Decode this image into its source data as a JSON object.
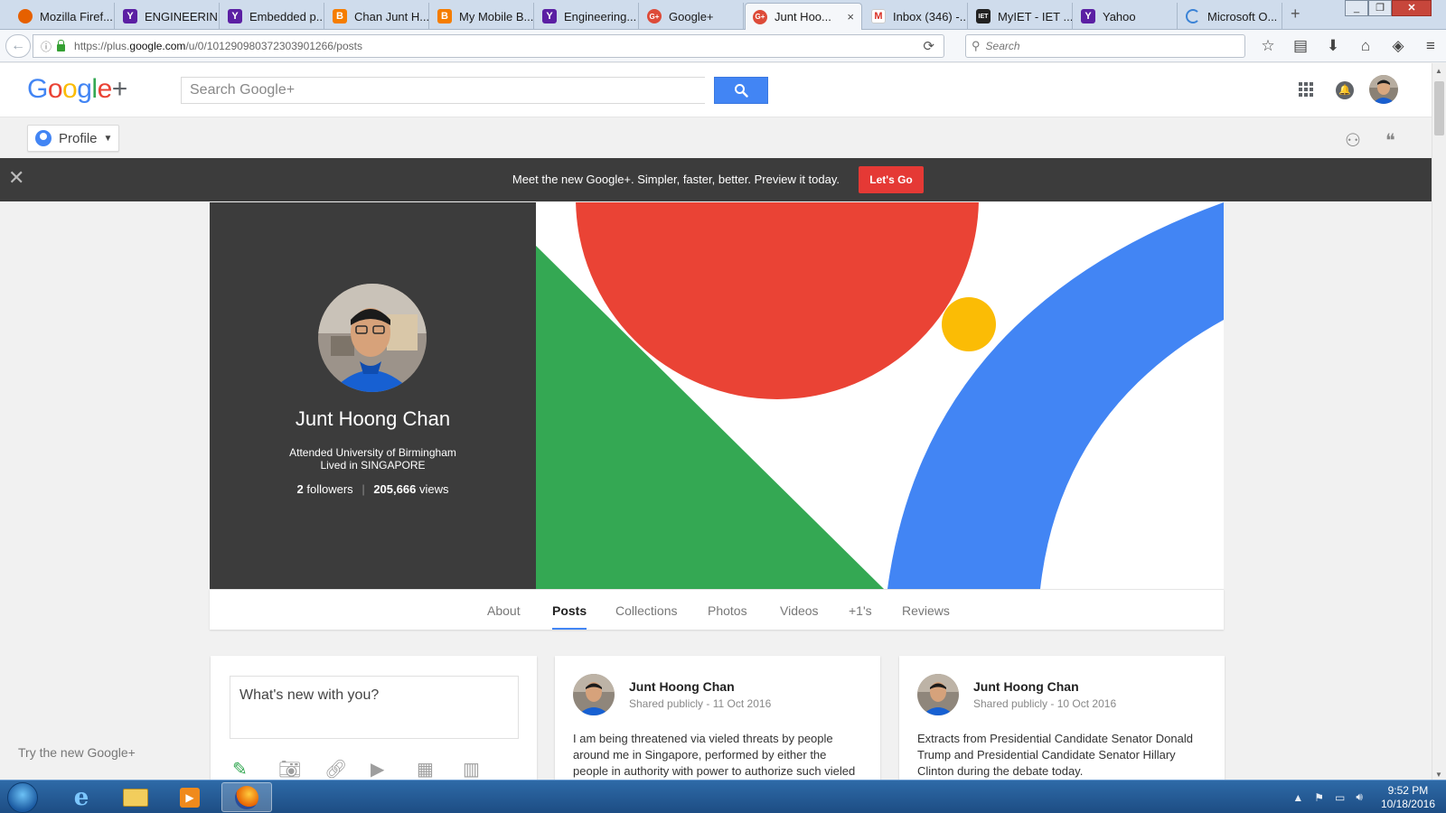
{
  "browser": {
    "tabs": [
      {
        "label": "Mozilla Firef...",
        "favicon": "firefox-icon"
      },
      {
        "label": "ENGINEERIN...",
        "favicon": "yahoo-icon"
      },
      {
        "label": "Embedded p...",
        "favicon": "yahoo-icon"
      },
      {
        "label": "Chan Junt H...",
        "favicon": "blogger-icon"
      },
      {
        "label": "My Mobile B...",
        "favicon": "blogger-icon"
      },
      {
        "label": "Engineering...",
        "favicon": "yahoo-icon"
      },
      {
        "label": "Google+",
        "favicon": "google-plus-icon"
      },
      {
        "label": "Junt Hoo...",
        "favicon": "google-plus-icon",
        "active": true
      },
      {
        "label": "Inbox (346) -...",
        "favicon": "gmail-icon"
      },
      {
        "label": "MyIET - IET ...",
        "favicon": "iet-icon"
      },
      {
        "label": "Yahoo",
        "favicon": "yahoo-icon"
      },
      {
        "label": "Microsoft O...",
        "favicon": "loading-icon"
      }
    ],
    "url_prefix": "https://plus.",
    "url_host": "google.com",
    "url_path": "/u/0/101290980372303901266/posts",
    "search_placeholder": "Search",
    "new_tab_label": "+",
    "close_tab_label": "×"
  },
  "gplus": {
    "search_placeholder": "Search Google+",
    "profile_button": "Profile",
    "banner": {
      "text": "Meet the new Google+.  Simpler, faster, better. Preview it today.",
      "button": "Let's Go"
    },
    "try_new": "Try the new Google+"
  },
  "profile": {
    "name": "Junt Hoong Chan",
    "education": "Attended University of Birmingham",
    "lived": "Lived in SINGAPORE",
    "followers_count": "2",
    "followers_label": "followers",
    "views_count": "205,666",
    "views_label": "views"
  },
  "profile_tabs": [
    {
      "label": "About"
    },
    {
      "label": "Posts",
      "active": true
    },
    {
      "label": "Collections"
    },
    {
      "label": "Photos"
    },
    {
      "label": "Videos"
    },
    {
      "label": "+1's"
    },
    {
      "label": "Reviews"
    }
  ],
  "composer": {
    "placeholder": "What's new with you?"
  },
  "posts": [
    {
      "author": "Junt Hoong Chan",
      "visibility": "Shared publicly",
      "date": "11 Oct 2016",
      "text": "I am being threatened via vieled threats by people around me in Singapore, performed by either the people in authority with power to authorize such vieled tatics as"
    },
    {
      "author": "Junt Hoong Chan",
      "visibility": "Shared publicly",
      "date": "10 Oct 2016",
      "text": "Extracts from Presidential Candidate Senator Donald Trump and Presidential Candidate Senator Hillary Clinton during the debate today."
    }
  ],
  "taskbar": {
    "time": "9:52 PM",
    "date": "10/18/2016"
  },
  "colors": {
    "google_blue": "#4285f4",
    "google_red": "#ea4335",
    "google_yellow": "#fbbc05",
    "google_green": "#34a853",
    "banner_bg": "#3c3c3c",
    "lets_go_red": "#e53935"
  }
}
